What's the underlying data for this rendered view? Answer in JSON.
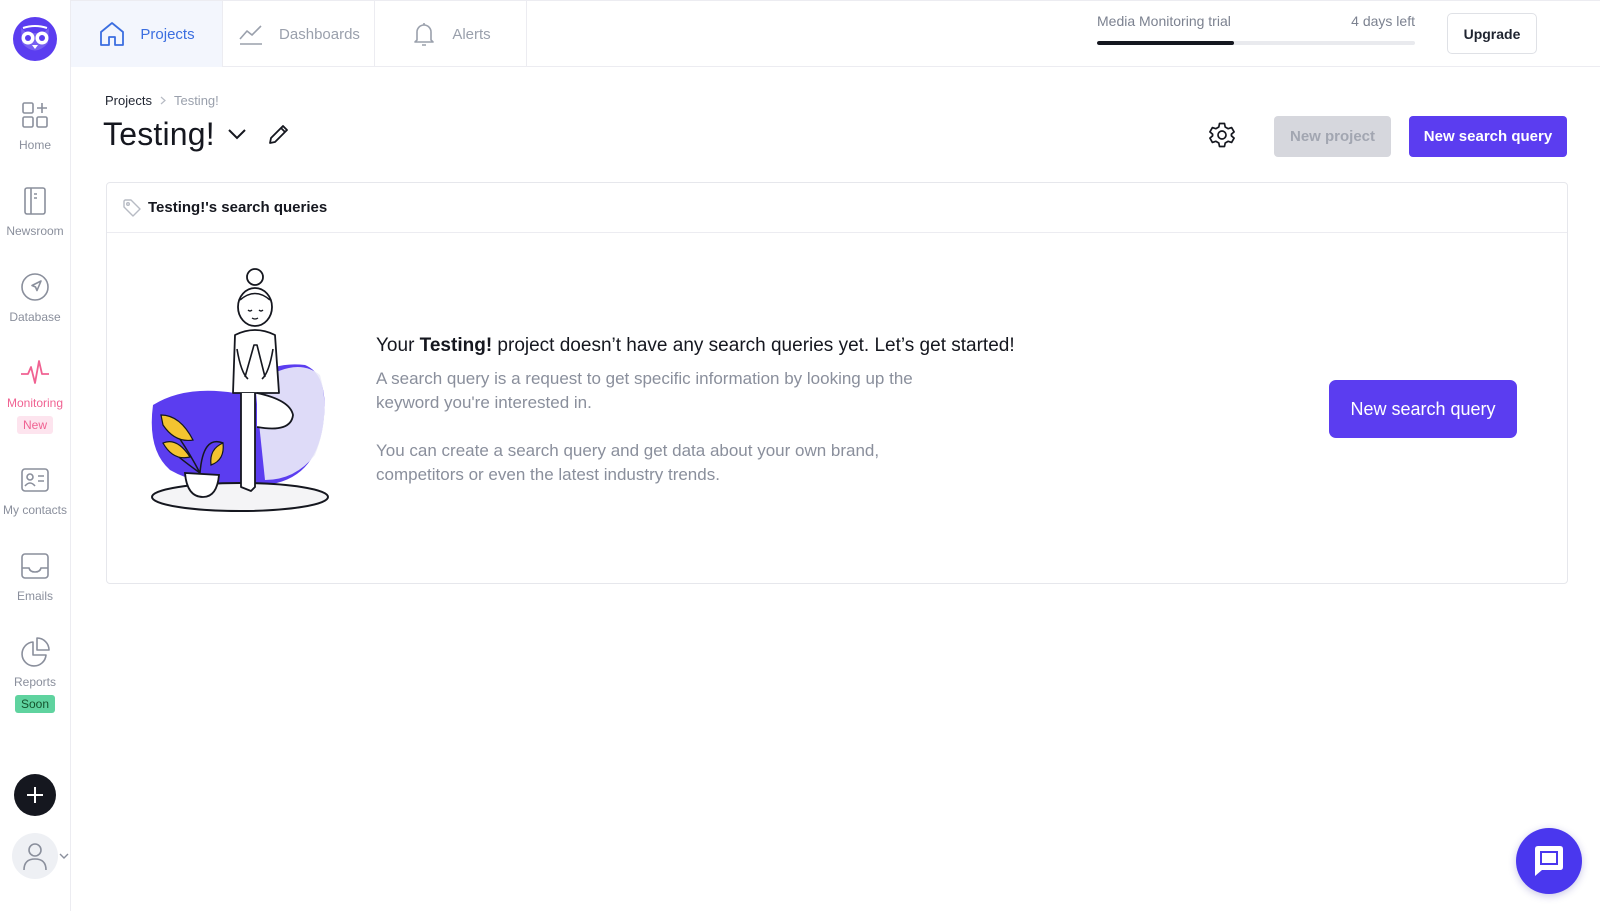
{
  "sidebar": {
    "items": [
      {
        "label": "Home",
        "icon": "grid-plus-icon"
      },
      {
        "label": "Newsroom",
        "icon": "newsroom-icon"
      },
      {
        "label": "Database",
        "icon": "navigation-icon"
      },
      {
        "label": "Monitoring",
        "icon": "pulse-icon",
        "badge": "New"
      },
      {
        "label": "My contacts",
        "icon": "contact-card-icon"
      },
      {
        "label": "Emails",
        "icon": "inbox-icon"
      },
      {
        "label": "Reports",
        "icon": "pie-chart-icon",
        "badge": "Soon"
      }
    ]
  },
  "topbar": {
    "tabs": [
      {
        "label": "Projects",
        "icon": "home-icon"
      },
      {
        "label": "Dashboards",
        "icon": "line-chart-icon"
      },
      {
        "label": "Alerts",
        "icon": "bell-icon"
      }
    ],
    "trial": {
      "label": "Media Monitoring trial",
      "remaining": "4 days left",
      "progress": 0.43
    },
    "upgrade_label": "Upgrade"
  },
  "header": {
    "breadcrumb": {
      "root": "Projects",
      "separator": ">",
      "current": "Testing!"
    },
    "title": "Testing!",
    "new_project_label": "New project",
    "new_query_label": "New search query"
  },
  "card": {
    "title": "Testing!'s search queries",
    "heading_pre": "Your ",
    "heading_project": "Testing!",
    "heading_post": " project doesn’t have any search queries yet. Let’s get started!",
    "para1": "A search query is a request to get specific information by looking up the keyword you're interested in.",
    "para2": "You can create a search query and get data about your own brand, competitors or even the latest industry trends.",
    "button_label": "New search query"
  },
  "colors": {
    "primary": "#5b3df0",
    "active_tab": "#3b6ee0",
    "monitoring": "#f06292",
    "soon_badge": "#5fd39f"
  }
}
